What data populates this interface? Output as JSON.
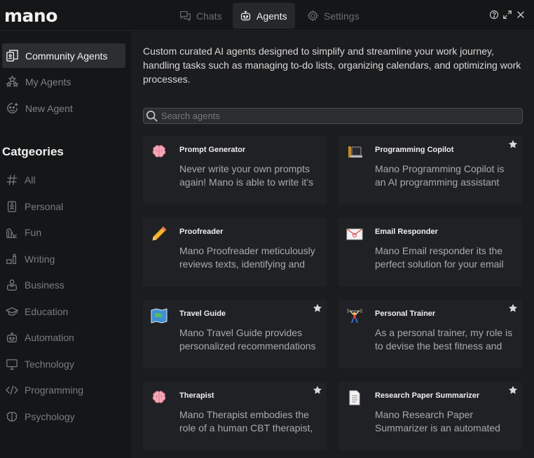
{
  "app": {
    "logo": "mano"
  },
  "tabs": [
    {
      "label": "Chats",
      "icon": "chat-icon"
    },
    {
      "label": "Agents",
      "icon": "robot-icon"
    },
    {
      "label": "Settings",
      "icon": "gear-icon"
    }
  ],
  "active_tab": "Agents",
  "sidebar": {
    "items": [
      {
        "label": "Community Agents",
        "icon": "community-agents-icon"
      },
      {
        "label": "My Agents",
        "icon": "stars-icon"
      },
      {
        "label": "New Agent",
        "icon": "new-agent-icon"
      }
    ],
    "categories_heading": "Catgeories",
    "categories": [
      {
        "label": "All",
        "icon": "hash-icon"
      },
      {
        "label": "Personal",
        "icon": "id-badge-icon"
      },
      {
        "label": "Fun",
        "icon": "roller-coaster-icon"
      },
      {
        "label": "Writing",
        "icon": "writing-icon"
      },
      {
        "label": "Business",
        "icon": "briefcase-person-icon"
      },
      {
        "label": "Education",
        "icon": "graduation-cap-icon"
      },
      {
        "label": "Automation",
        "icon": "robot-icon"
      },
      {
        "label": "Technology",
        "icon": "monitor-icon"
      },
      {
        "label": "Programming",
        "icon": "code-icon"
      },
      {
        "label": "Psychology",
        "icon": "brain-icon"
      }
    ]
  },
  "main": {
    "intro": "Custom curated AI agents designed to simplify and streamline your work journey, handling tasks such as managing to-do lists, organizing calendars, and optimizing work processes.",
    "search_placeholder": "Search agents",
    "agents": [
      {
        "title": "Prompt Generator",
        "desc": "Never write your own prompts again! Mano is able to write it's",
        "icon": "brain-emoji",
        "starred": false
      },
      {
        "title": "Programming Copilot",
        "desc": "Mano Programming Copilot is an AI programming assistant",
        "icon": "laptop-emoji",
        "starred": true
      },
      {
        "title": "Proofreader",
        "desc": "Mano Proofreader meticulously reviews texts, identifying and",
        "icon": "pencil-emoji",
        "starred": false
      },
      {
        "title": "Email Responder",
        "desc": "Mano Email responder its the perfect solution for your email",
        "icon": "envelope-emoji",
        "starred": false
      },
      {
        "title": "Travel Guide",
        "desc": "Mano Travel Guide provides personalized recommendations",
        "icon": "map-emoji",
        "starred": true
      },
      {
        "title": "Personal Trainer",
        "desc": "As a personal trainer, my role is to devise the best fitness and",
        "icon": "weightlifter-emoji",
        "starred": true
      },
      {
        "title": "Therapist",
        "desc": "Mano Therapist embodies the role of a human CBT therapist,",
        "icon": "brain-emoji",
        "starred": true
      },
      {
        "title": "Research Paper Summarizer",
        "desc": "Mano Research Paper Summarizer is an automated",
        "icon": "document-emoji",
        "starred": true
      }
    ]
  },
  "colors": {
    "background": "#151617",
    "panel": "#1b1c1e",
    "card": "#202124",
    "active": "#2c2e31"
  }
}
